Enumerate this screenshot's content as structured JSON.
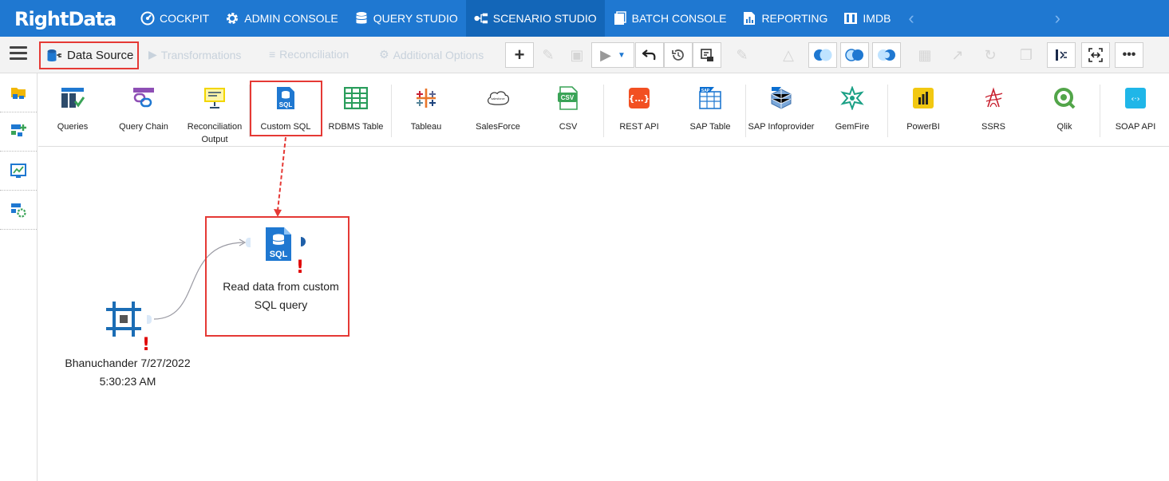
{
  "app": {
    "logo_text": "RightData"
  },
  "nav": {
    "items": [
      {
        "label": "COCKPIT",
        "icon": "speedometer-icon"
      },
      {
        "label": "ADMIN CONSOLE",
        "icon": "gear-icon"
      },
      {
        "label": "QUERY STUDIO",
        "icon": "database-icon"
      },
      {
        "label": "SCENARIO STUDIO",
        "icon": "workflow-icon"
      },
      {
        "label": "BATCH CONSOLE",
        "icon": "batch-icon"
      },
      {
        "label": "REPORTING",
        "icon": "report-icon"
      },
      {
        "label": "IMDB",
        "icon": "imdb-icon"
      }
    ],
    "active": "SCENARIO STUDIO"
  },
  "toolbar": {
    "data_source_label": "Data Source",
    "transformations_label": "Transformations",
    "reconciliation_label": "Reconciliation",
    "additional_options_label": "Additional Options"
  },
  "sources": [
    {
      "label": "Queries",
      "icon": "queries-icon"
    },
    {
      "label": "Query Chain",
      "icon": "query-chain-icon"
    },
    {
      "label": "Reconciliation Output",
      "icon": "reconciliation-output-icon"
    },
    {
      "label": "Custom SQL",
      "icon": "custom-sql-icon"
    },
    {
      "label": "RDBMS Table",
      "icon": "rdbms-table-icon"
    },
    {
      "label": "Tableau",
      "icon": "tableau-icon"
    },
    {
      "label": "SalesForce",
      "icon": "salesforce-icon"
    },
    {
      "label": "CSV",
      "icon": "csv-icon"
    },
    {
      "label": "REST API",
      "icon": "rest-api-icon"
    },
    {
      "label": "SAP Table",
      "icon": "sap-table-icon"
    },
    {
      "label": "SAP Infoprovider",
      "icon": "sap-infoprovider-icon"
    },
    {
      "label": "GemFire",
      "icon": "gemfire-icon"
    },
    {
      "label": "PowerBI",
      "icon": "powerbi-icon"
    },
    {
      "label": "SSRS",
      "icon": "ssrs-icon"
    },
    {
      "label": "Qlik",
      "icon": "qlik-icon"
    },
    {
      "label": "SOAP API",
      "icon": "soap-api-icon"
    }
  ],
  "canvas": {
    "start_node": {
      "line1": "Bhanuchander 7/27/2022",
      "line2": "5:30:23 AM"
    },
    "sql_node": {
      "line1": "Read data from custom",
      "line2": "SQL query",
      "icon_text": "SQL"
    },
    "warning_mark": "!"
  },
  "colors": {
    "nav_bg": "#1f78d1",
    "nav_active": "#1366b8",
    "highlight": "#e53935",
    "warning": "#e00000"
  }
}
